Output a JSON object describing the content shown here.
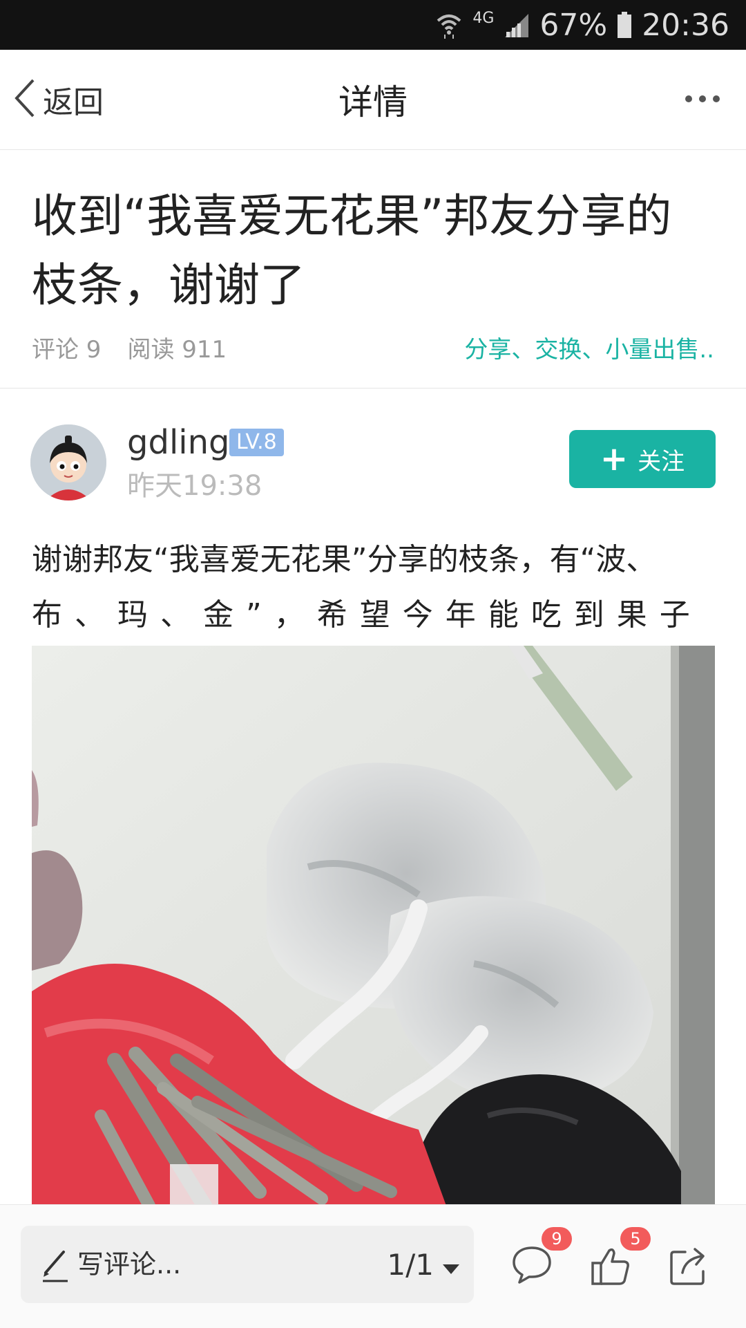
{
  "status_bar": {
    "network": "4G",
    "battery": "67%",
    "time": "20:36"
  },
  "nav": {
    "back_label": "返回",
    "title": "详情"
  },
  "post": {
    "title": "收到“我喜爱无花果”邦友分享的枝条，谢谢了",
    "comments_stat": "评论 9",
    "reads_stat": "阅读 911",
    "category_tags": "分享、交换、小量出售..",
    "body_line1": "谢谢邦友“我喜爱无花果”分享的枝条，有“波、",
    "body_line2": "布、玛、金”，希望今年能吃到果子"
  },
  "author": {
    "name": "gdling",
    "level": "LV.8",
    "time": "昨天19:38",
    "follow_label": "关注"
  },
  "bottom_bar": {
    "comment_placeholder": "写评论...",
    "page_indicator": "1/1",
    "comment_count": "9",
    "like_count": "5"
  },
  "colors": {
    "accent": "#1ab3a3",
    "badge": "#f25b5b",
    "level_badge": "#8fb7ea",
    "status_bar": "#121212"
  },
  "icons": {
    "back": "chevron-left-icon",
    "more": "more-dots-icon",
    "comment": "speech-bubble-icon",
    "like": "thumbs-up-icon",
    "share": "share-icon",
    "write": "pen-icon",
    "dropdown": "caret-down-icon"
  }
}
